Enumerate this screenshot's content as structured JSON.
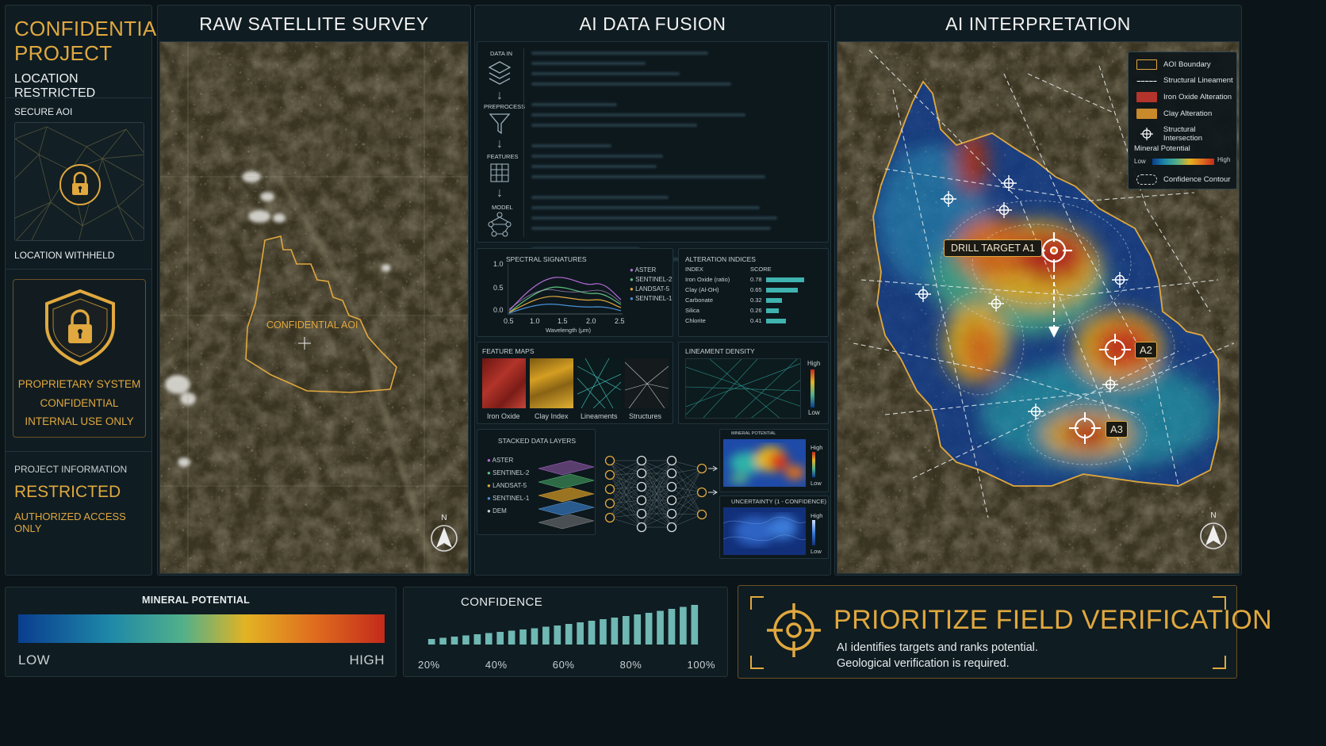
{
  "left": {
    "title_line1": "CONFIDENTIAL",
    "title_line2": "PROJECT",
    "subtitle": "LOCATION RESTRICTED",
    "secure_aoi": "SECURE AOI",
    "location_withheld": "LOCATION WITHHELD",
    "shield_lines": [
      "PROPRIETARY SYSTEM",
      "CONFIDENTIAL",
      "INTERNAL USE ONLY"
    ],
    "project_info": "PROJECT INFORMATION",
    "restricted": "RESTRICTED",
    "authorized": "AUTHORIZED ACCESS ONLY"
  },
  "raw": {
    "title": "RAW SATELLITE SURVEY",
    "aoi_label": "CONFIDENTIAL AOI",
    "north": "N"
  },
  "fusion": {
    "title": "AI DATA FUSION",
    "pipeline": [
      "DATA IN",
      "PREPROCESS",
      "FEATURES",
      "MODEL"
    ],
    "spectral": {
      "title": "SPECTRAL SIGNATURES",
      "yticks": [
        "1.0",
        "0.5",
        "0.0"
      ],
      "xticks": [
        "0.5",
        "1.0",
        "1.5",
        "2.0",
        "2.5"
      ],
      "xlabel": "Wavelength (μm)",
      "series": [
        {
          "name": "ASTER",
          "color": "#b56ad6"
        },
        {
          "name": "SENTINEL-2",
          "color": "#5cc07a"
        },
        {
          "name": "LANDSAT-5",
          "color": "#e0a83e"
        },
        {
          "name": "SENTINEL-1",
          "color": "#4a8fd6"
        }
      ]
    },
    "alteration": {
      "title": "ALTERATION INDICES",
      "col_index": "INDEX",
      "col_score": "SCORE",
      "rows": [
        {
          "name": "Iron Oxide (ratio)",
          "score": "0.78",
          "value": 0.78
        },
        {
          "name": "Clay (Al-OH)",
          "score": "0.65",
          "value": 0.65
        },
        {
          "name": "Carbonate",
          "score": "0.32",
          "value": 0.32
        },
        {
          "name": "Silica",
          "score": "0.26",
          "value": 0.26
        },
        {
          "name": "Chlorite",
          "score": "0.41",
          "value": 0.41
        }
      ]
    },
    "feature_maps": {
      "title": "FEATURE MAPS",
      "items": [
        "Iron Oxide",
        "Clay Index",
        "Lineaments",
        "Structures"
      ]
    },
    "lineament": {
      "title": "LINEAMENT DENSITY",
      "high": "High",
      "low": "Low"
    },
    "stacked": {
      "title": "STACKED DATA LAYERS",
      "layers": [
        {
          "name": "ASTER",
          "color": "#b56ad6"
        },
        {
          "name": "SENTINEL-2",
          "color": "#5cc07a"
        },
        {
          "name": "LANDSAT-5",
          "color": "#e0a83e"
        },
        {
          "name": "SENTINEL-1",
          "color": "#4a8fd6"
        },
        {
          "name": "DEM",
          "color": "#c8d0d3"
        }
      ]
    },
    "mineral_small": {
      "title": "MINERAL POTENTIAL",
      "high": "High",
      "low": "Low"
    },
    "uncertainty": {
      "title": "UNCERTAINTY (1 - CONFIDENCE)",
      "high": "High",
      "low": "Low"
    }
  },
  "interp": {
    "title": "AI INTERPRETATION",
    "legend": {
      "aoi": "AOI Boundary",
      "lineament": "Structural Lineament",
      "iron": "Iron Oxide Alteration",
      "clay": "Clay Alteration",
      "intersection": "Structural Intersection",
      "mineral": "Mineral Potential",
      "low": "Low",
      "high": "High",
      "contour": "Confidence Contour"
    },
    "targets": {
      "a1": "DRILL TARGET A1",
      "a2": "A2",
      "a3": "A3"
    },
    "north": "N"
  },
  "bottom": {
    "mineral": {
      "title": "MINERAL POTENTIAL",
      "low": "LOW",
      "high": "HIGH"
    },
    "confidence": {
      "title": "CONFIDENCE",
      "ticks": [
        "20%",
        "40%",
        "60%",
        "80%",
        "100%"
      ]
    },
    "cta": {
      "title": "PRIORITIZE FIELD VERIFICATION",
      "line1": "AI identifies targets and ranks potential.",
      "line2": "Geological verification is required."
    }
  },
  "chart_data": {
    "type": "bar",
    "title": "CONFIDENCE",
    "xlabel": "",
    "ylabel": "",
    "x_ticks": [
      "20%",
      "40%",
      "60%",
      "80%",
      "100%"
    ],
    "values": [
      0.14,
      0.17,
      0.2,
      0.23,
      0.26,
      0.29,
      0.32,
      0.35,
      0.38,
      0.41,
      0.45,
      0.48,
      0.52,
      0.56,
      0.6,
      0.64,
      0.68,
      0.72,
      0.76,
      0.8,
      0.85,
      0.9,
      0.95,
      1.0
    ],
    "ylim": [
      0,
      1
    ],
    "grid": false,
    "legend": "none"
  },
  "colors": {
    "accent": "#e0a83e",
    "panel": "#0f1c22",
    "bar": "#6fb8b3",
    "gradient": [
      "#0a3d8f",
      "#1e88a8",
      "#52b08a",
      "#e2b323",
      "#e0701f",
      "#c42a1b"
    ]
  }
}
